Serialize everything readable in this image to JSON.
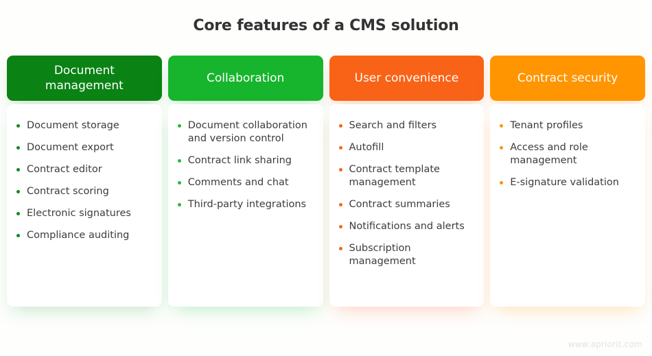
{
  "page": {
    "title": "Core features of a CMS solution",
    "watermark": "www.apriorit.com",
    "background_color": "#fefefd",
    "title_color": "#333333",
    "item_text_color": "#3c3c3c",
    "watermark_color": "#e3e3e0"
  },
  "columns": [
    {
      "header": "Document management",
      "header_color": "#0a8214",
      "bullet_color": "#0f8a1a",
      "shadow_color": "rgba(60, 170, 80, 0.30)",
      "items": [
        "Document storage",
        "Document export",
        "Contract editor",
        "Contract scoring",
        "Electronic signatures",
        "Compliance auditing"
      ]
    },
    {
      "header": "Collaboration",
      "header_color": "#17b52e",
      "bullet_color": "#1fbd33",
      "shadow_color": "rgba(60, 200, 90, 0.32)",
      "items": [
        "Document collaboration and version control",
        "Contract link sharing",
        "Comments and chat",
        "Third-party integrations"
      ]
    },
    {
      "header": "User convenience",
      "header_color": "#f96317",
      "bullet_color": "#f96317",
      "shadow_color": "rgba(249, 110, 50, 0.30)",
      "items": [
        "Search and filters",
        "Autofill",
        "Contract template management",
        "Contract summaries",
        "Notifications and alerts",
        "Subscription management"
      ]
    },
    {
      "header": "Contract security",
      "header_color": "#ff9500",
      "bullet_color": "#ff9500",
      "shadow_color": "rgba(255, 160, 30, 0.30)",
      "items": [
        "Tenant profiles",
        "Access and role management",
        "E-signature validation"
      ]
    }
  ]
}
